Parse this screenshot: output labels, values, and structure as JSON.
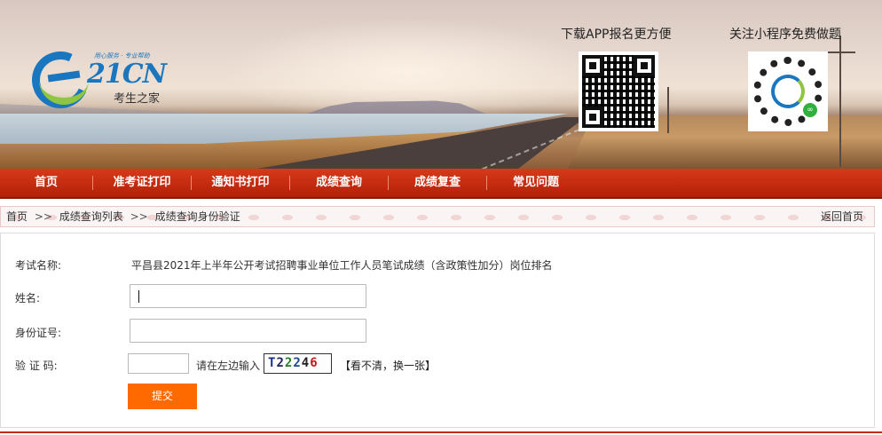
{
  "banner": {
    "logo": {
      "brand": "21CN",
      "slogan": "用心服务 · 专业帮助",
      "subtitle": "考生之家"
    },
    "app_promo": {
      "title": "下载APP报名更方便"
    },
    "mini_promo": {
      "title": "关注小程序免费做题"
    }
  },
  "nav": {
    "items": [
      {
        "label": "首页"
      },
      {
        "label": "准考证打印"
      },
      {
        "label": "通知书打印"
      },
      {
        "label": "成绩查询"
      },
      {
        "label": "成绩复查"
      },
      {
        "label": "常见问题"
      }
    ]
  },
  "breadcrumb": {
    "home": "首页",
    "sep": ">>",
    "list": "成绩查询列表",
    "current": "成绩查询身份验证",
    "back": "返回首页"
  },
  "form": {
    "exam_label": "考试名称:",
    "exam_value": "平昌县2021年上半年公开考试招聘事业单位工作人员笔试成绩（含政策性加分）岗位排名",
    "name_label": "姓名:",
    "name_value": "",
    "id_label": "身份证号:",
    "id_value": "",
    "captcha_label": "验 证 码:",
    "captcha_value": "",
    "captcha_hint": "请在左边输入",
    "captcha_chars": [
      "T",
      "2",
      "2",
      "2",
      "4",
      "6"
    ],
    "refresh_label": "【看不清，换一张】",
    "submit_label": "提交"
  },
  "colors": {
    "nav_red": "#c42b10",
    "submit_orange": "#ff6a00",
    "brand_blue": "#1a77bf",
    "brand_green": "#8ec63f"
  }
}
